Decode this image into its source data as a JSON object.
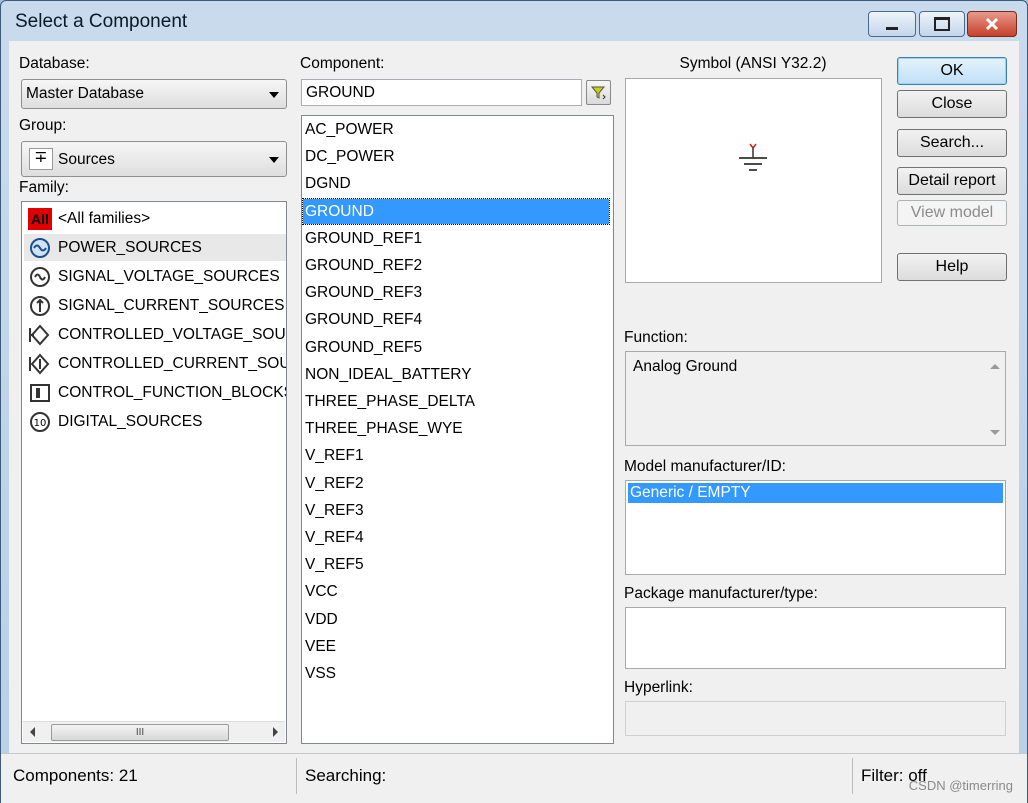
{
  "window": {
    "title": "Select a Component"
  },
  "database": {
    "label": "Database:",
    "value": "Master Database"
  },
  "group": {
    "label": "Group:",
    "value": "Sources"
  },
  "family": {
    "label": "Family:",
    "items": [
      {
        "label": "<All families>",
        "icon": "all-families-icon"
      },
      {
        "label": "POWER_SOURCES",
        "icon": "power-sources-icon"
      },
      {
        "label": "SIGNAL_VOLTAGE_SOURCES",
        "icon": "signal-voltage-icon"
      },
      {
        "label": "SIGNAL_CURRENT_SOURCES",
        "icon": "signal-current-icon"
      },
      {
        "label": "CONTROLLED_VOLTAGE_SOUR",
        "icon": "controlled-voltage-icon"
      },
      {
        "label": "CONTROLLED_CURRENT_SOUF",
        "icon": "controlled-current-icon"
      },
      {
        "label": "CONTROL_FUNCTION_BLOCKS",
        "icon": "control-function-icon"
      },
      {
        "label": "DIGITAL_SOURCES",
        "icon": "digital-sources-icon"
      }
    ],
    "scroll_grip": "III"
  },
  "component": {
    "label": "Component:",
    "value": "GROUND",
    "items": [
      "AC_POWER",
      "DC_POWER",
      "DGND",
      "GROUND",
      "GROUND_REF1",
      "GROUND_REF2",
      "GROUND_REF3",
      "GROUND_REF4",
      "GROUND_REF5",
      "NON_IDEAL_BATTERY",
      "THREE_PHASE_DELTA",
      "THREE_PHASE_WYE",
      "V_REF1",
      "V_REF2",
      "V_REF3",
      "V_REF4",
      "V_REF5",
      "VCC",
      "VDD",
      "VEE",
      "VSS"
    ]
  },
  "symbol": {
    "label": "Symbol (ANSI Y32.2)"
  },
  "function": {
    "label": "Function:",
    "value": "Analog Ground"
  },
  "model": {
    "label": "Model manufacturer/ID:",
    "value": "Generic / EMPTY"
  },
  "package": {
    "label": "Package manufacturer/type:",
    "value": ""
  },
  "hyperlink": {
    "label": "Hyperlink:",
    "value": ""
  },
  "buttons": {
    "ok": "OK",
    "close": "Close",
    "search": "Search...",
    "detail_report": "Detail report",
    "view_model": "View model",
    "help": "Help"
  },
  "status": {
    "components": "Components: 21",
    "searching": "Searching:",
    "filter": "Filter: off",
    "watermark": "CSDN @timerring"
  },
  "colors": {
    "selection": "#3399ff",
    "window_frame": "#b9cfe6"
  }
}
